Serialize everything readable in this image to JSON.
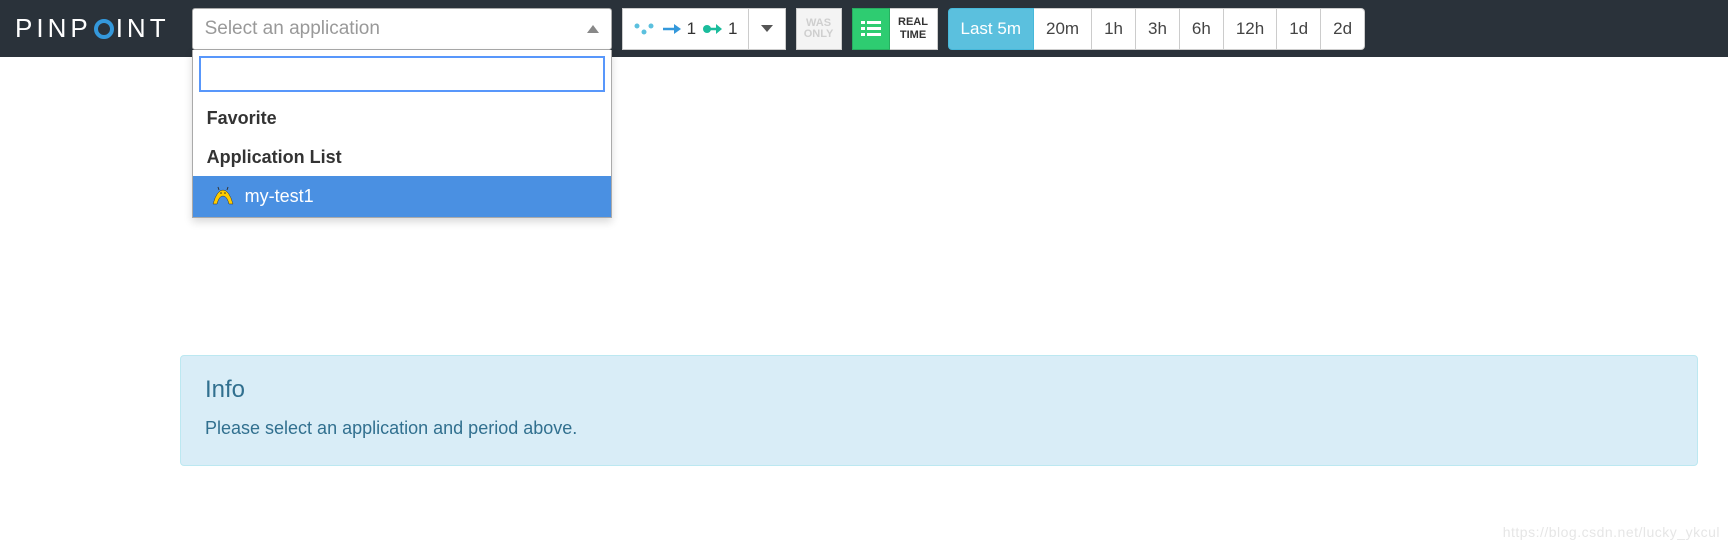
{
  "brand": {
    "name": "PINPOINT"
  },
  "appSelect": {
    "placeholder": "Select an application",
    "sections": {
      "favorite": "Favorite",
      "appList": "Application List"
    },
    "items": [
      {
        "name": "my-test1",
        "type": "tomcat"
      }
    ]
  },
  "depth": {
    "inbound": "1",
    "outbound": "1"
  },
  "wasOnly": {
    "line1": "WAS",
    "line2": "ONLY"
  },
  "realtime": {
    "line1": "REAL",
    "line2": "TIME"
  },
  "timeRanges": [
    "Last 5m",
    "20m",
    "1h",
    "3h",
    "6h",
    "12h",
    "1d",
    "2d"
  ],
  "timeActiveIndex": 0,
  "info": {
    "title": "Info",
    "body": "Please select an application and period above."
  },
  "watermark": "https://blog.csdn.net/lucky_ykcul"
}
